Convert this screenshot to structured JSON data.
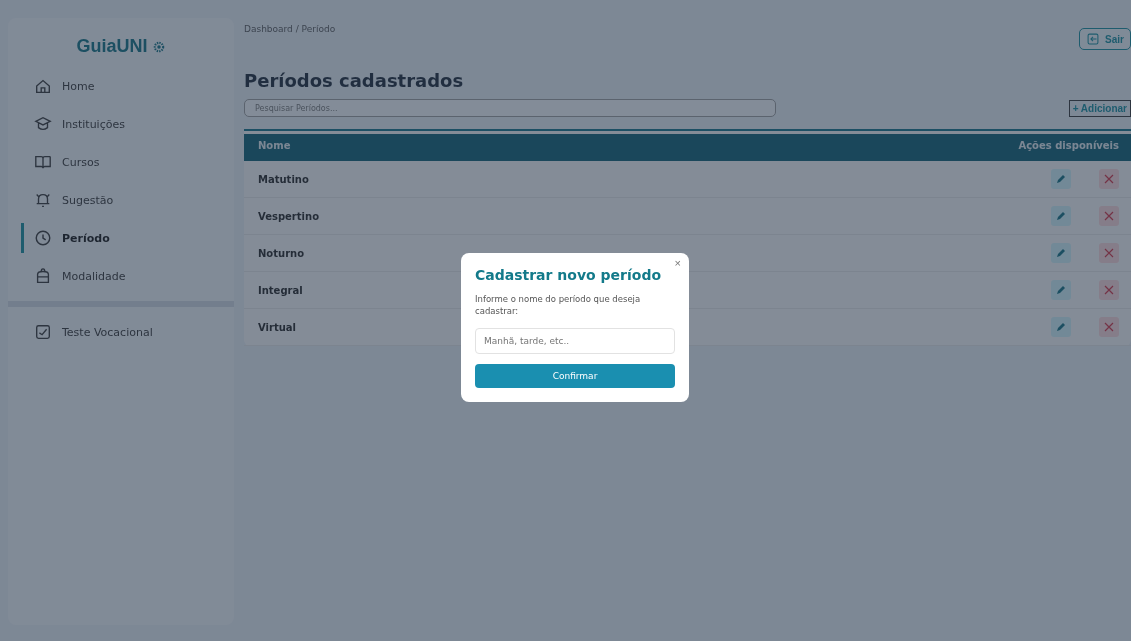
{
  "sidebar": {
    "logo": "GuiaUNI",
    "items": [
      {
        "label": "Home",
        "kind": "home",
        "selected": false
      },
      {
        "label": "Instituições",
        "kind": "school",
        "selected": false
      },
      {
        "label": "Cursos",
        "kind": "book",
        "selected": false
      },
      {
        "label": "Sugestão",
        "kind": "bell",
        "selected": false
      },
      {
        "label": "Período",
        "kind": "clock",
        "selected": true
      },
      {
        "label": "Modalidade",
        "kind": "bag",
        "selected": false
      }
    ],
    "footer_item": {
      "label": "Teste Vocacional",
      "kind": "check",
      "selected": false
    }
  },
  "breadcrumb": "Dashboard / Período",
  "logout_button": "Sair",
  "title": "Períodos cadastrados",
  "search": {
    "placeholder": "Pesquisar Períodos..."
  },
  "add_button": "+ Adicionar",
  "table": {
    "columns": [
      "Nome",
      "Ações disponíveis"
    ],
    "rows": [
      {
        "name": "Matutino"
      },
      {
        "name": "Vespertino"
      },
      {
        "name": "Noturno"
      },
      {
        "name": "Integral"
      },
      {
        "name": "Virtual"
      }
    ]
  },
  "modal": {
    "close": "×",
    "title": "Cadastrar novo período",
    "message": "Informe o nome do período que deseja cadastrar:",
    "input": {
      "placeholder": "Manhã, tarde, etc.."
    },
    "confirm_button": "Confirmar"
  }
}
